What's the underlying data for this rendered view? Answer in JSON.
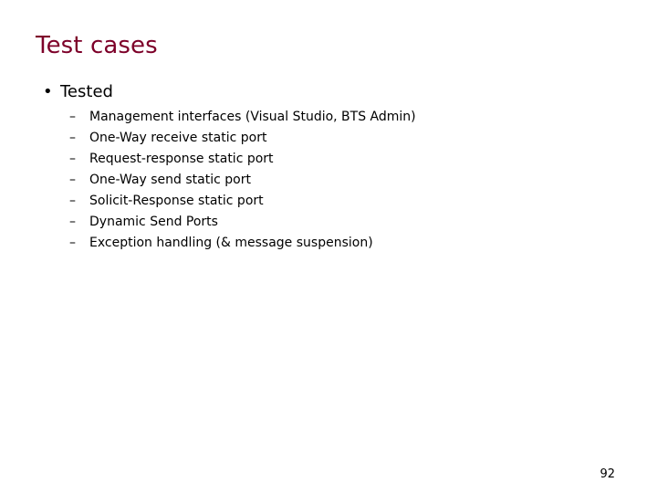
{
  "slide": {
    "title": "Test cases",
    "title_color": "#7d0029",
    "background_color": "#ffffff",
    "text_color": "#000000",
    "page_number": "92"
  },
  "content": {
    "level1": {
      "marker": "•",
      "text": "Tested"
    },
    "level2_marker": "–",
    "level2_items": [
      {
        "text": "Management interfaces (Visual Studio, BTS Admin)"
      },
      {
        "text": "One-Way receive static port"
      },
      {
        "text": "Request-response static port"
      },
      {
        "text": "One-Way send static port"
      },
      {
        "text": "Solicit-Response static port"
      },
      {
        "text": "Dynamic Send Ports"
      },
      {
        "text": "Exception handling (& message suspension)"
      }
    ]
  }
}
